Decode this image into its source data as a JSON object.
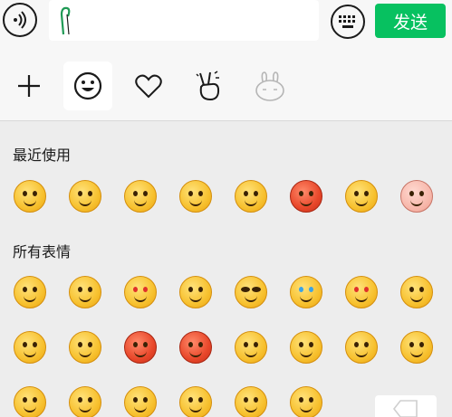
{
  "input_bar": {
    "send_label": "发送",
    "text_value": ""
  },
  "tabs": [
    {
      "icon": "plus-icon"
    },
    {
      "icon": "smiley-icon"
    },
    {
      "icon": "heart-icon"
    },
    {
      "icon": "victory-hand-icon"
    },
    {
      "icon": "rabbit-sticker-icon"
    }
  ],
  "sections": {
    "recent_title": "最近使用",
    "all_title": "所有表情"
  },
  "recent_emojis": [
    "face-with-tears-of-joy",
    "blushing-face",
    "grinning-face",
    "squinting-tongue-face",
    "laughing-crying-face",
    "star-struck-face",
    "sunglasses-cool-face",
    "pig-face"
  ],
  "all_emojis_row1": [
    "smiling-face",
    "worried-face",
    "heart-eyes-face",
    "angry-face",
    "cool-sunglasses-face",
    "crying-face",
    "heart-eyes-smile-face",
    "zipped-mouth-face"
  ],
  "all_emojis_row2": [
    "sleepy-face",
    "sweating-face",
    "shocked-red-face",
    "furious-red-face",
    "winking-tongue-face",
    "grinning-teeth-face",
    "surprised-face",
    "frowning-face"
  ],
  "all_emojis_row3": [
    "smirk-face",
    "tongue-face",
    "dizzy-face",
    "thinking-face",
    "happy-face",
    "nervous-face"
  ],
  "colors": {
    "send_green": "#07c160",
    "panel_bg": "#ededed",
    "bar_bg": "#f7f7f7"
  }
}
